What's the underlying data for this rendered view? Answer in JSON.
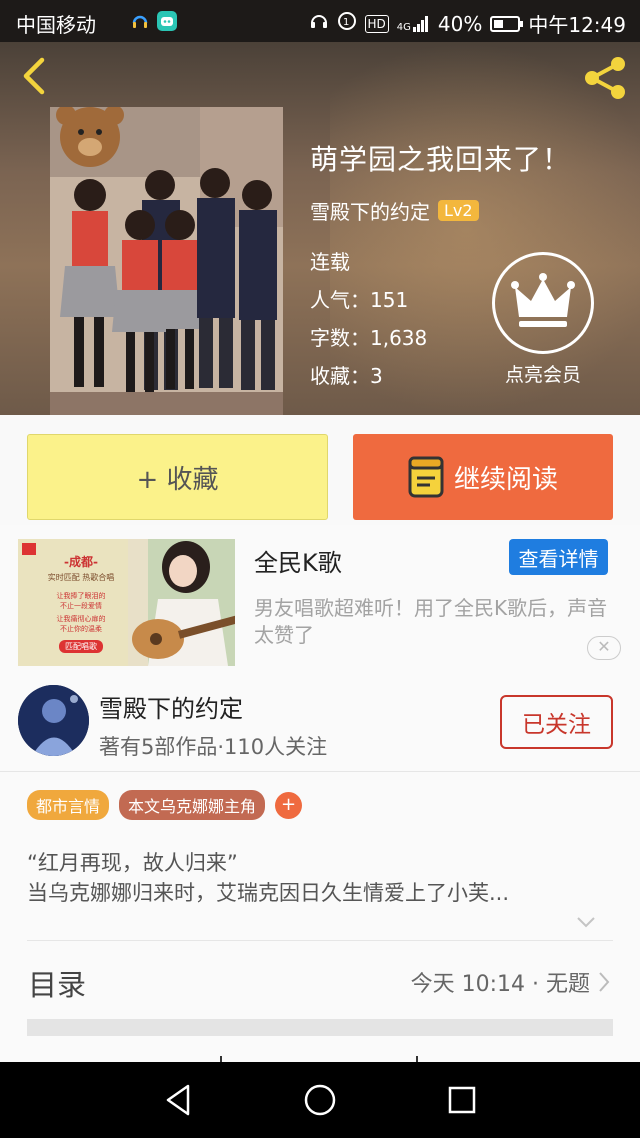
{
  "status_bar": {
    "carrier": "中国移动",
    "network_badge": "HD",
    "signal": "4G",
    "battery": "40%",
    "battery_level": 0.4,
    "time": "中午12:49"
  },
  "header": {
    "back_icon": "chevron-left-icon",
    "share_icon": "share-icon",
    "accent_color": "#f3d43d"
  },
  "book": {
    "title": "萌学园之我回来了！",
    "author": "雪殿下的约定",
    "level": "Lv2",
    "status": "连载",
    "popularity": "人气：151",
    "word_count": "字数：1,638",
    "favorites": "收藏：3"
  },
  "vip": {
    "icon": "crown-icon",
    "label": "点亮会员"
  },
  "actions": {
    "collect": "+ 收藏",
    "read": "继续阅读",
    "read_icon": "book-icon",
    "collect_color": "#fbf28a",
    "read_color": "#ef6a3f"
  },
  "ad": {
    "title": "全民K歌",
    "detail_button": "查看详情",
    "text": "男友唱歌超难听！用了全民K歌后，声音太赞了",
    "close": "✕",
    "image_texts": {
      "city": "-成都-",
      "line1": "实时匹配 热歌合唱",
      "line2": "让我捧了眼泪的",
      "line3": "不止一段爱情",
      "line4": "让我痛彻心扉的",
      "line5": "不止你的温柔",
      "btn": "匹配唱歌"
    }
  },
  "author_card": {
    "name": "雪殿下的约定",
    "stats": "著有5部作品·110人关注",
    "follow": "已关注"
  },
  "tags": [
    "都市言情",
    "本文乌克娜娜主角"
  ],
  "tag_add": "+",
  "intro": {
    "line1": "“红月再现，故人归来”",
    "line2": "当乌克娜娜归来时，艾瑞克因日久生情爱上了小芙..."
  },
  "catalog": {
    "title": "目录",
    "update": "今天 10:14 · 无题"
  },
  "nav": {
    "back": "back-triangle-icon",
    "home": "home-circle-icon",
    "recent": "recent-square-icon"
  }
}
